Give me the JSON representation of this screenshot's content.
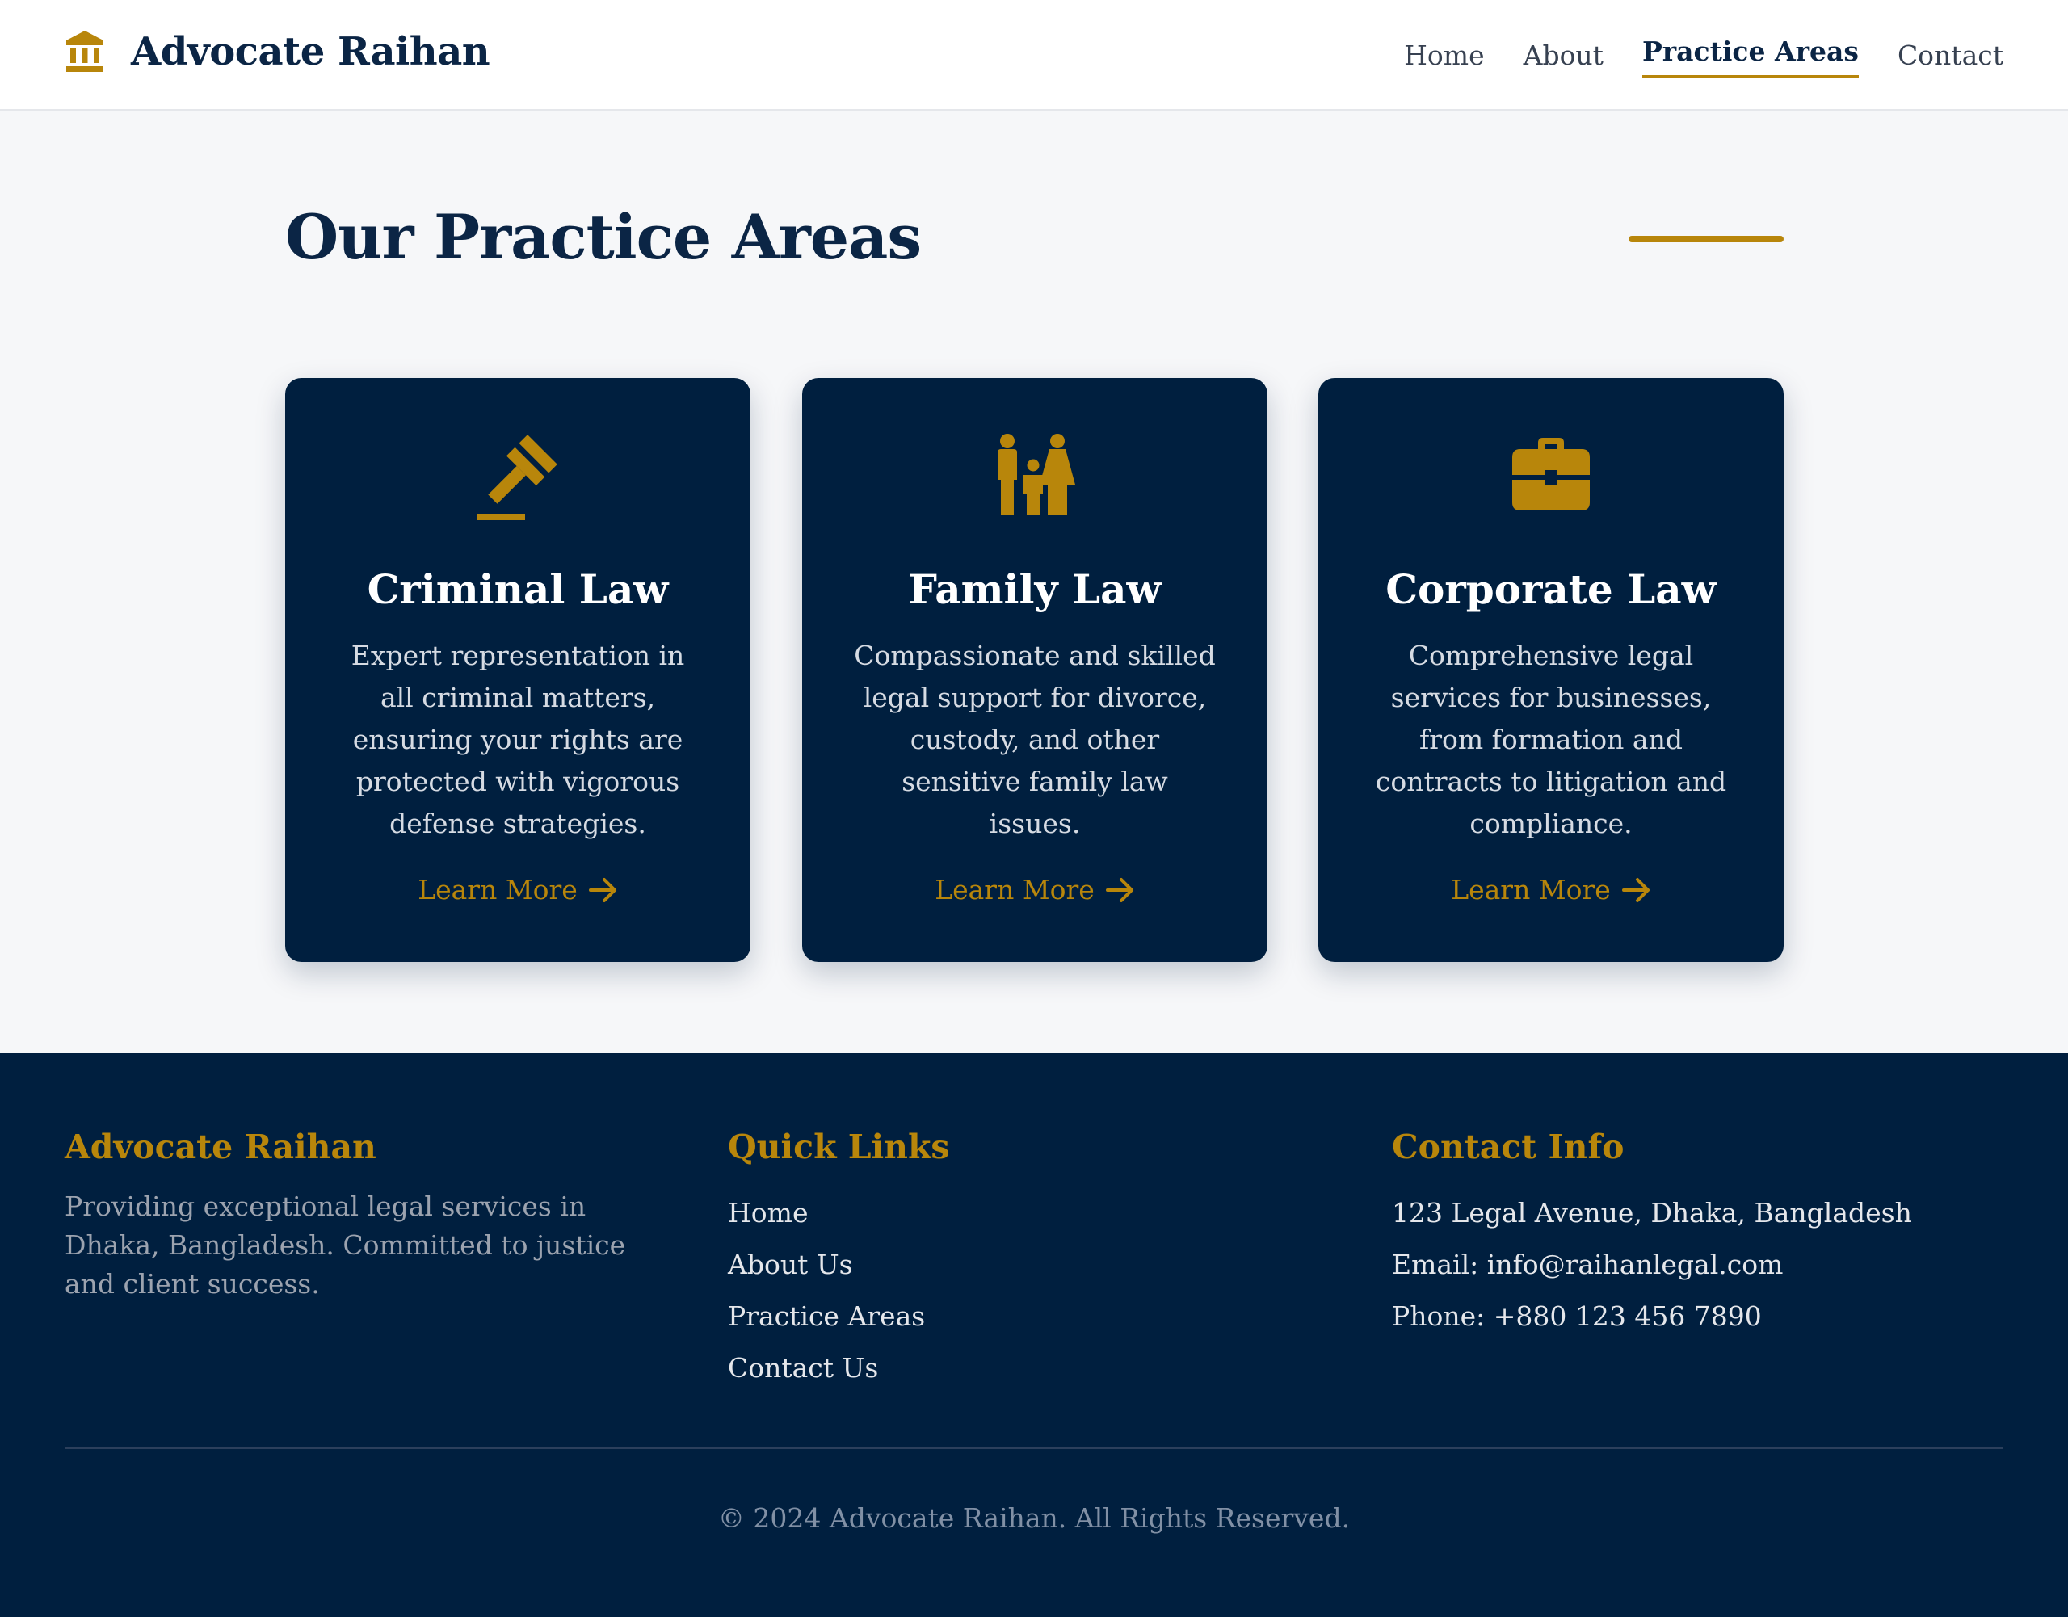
{
  "brand": {
    "name": "Advocate Raihan",
    "icon": "building-columns-icon"
  },
  "nav": {
    "items": [
      {
        "label": "Home",
        "active": false
      },
      {
        "label": "About",
        "active": false
      },
      {
        "label": "Practice Areas",
        "active": true
      },
      {
        "label": "Contact",
        "active": false
      }
    ]
  },
  "main": {
    "title": "Our Practice Areas",
    "cards": [
      {
        "icon": "gavel-icon",
        "title": "Criminal Law",
        "description": "Expert representation in all criminal matters, ensuring your rights are protected with vigorous defense strategies.",
        "link_label": "Learn More"
      },
      {
        "icon": "family-icon",
        "title": "Family Law",
        "description": "Compassionate and skilled legal support for divorce, custody, and other sensitive family law issues.",
        "link_label": "Learn More"
      },
      {
        "icon": "briefcase-icon",
        "title": "Corporate Law",
        "description": "Comprehensive legal services for businesses, from formation and contracts to litigation and compliance.",
        "link_label": "Learn More"
      }
    ]
  },
  "footer": {
    "about": {
      "heading": "Advocate Raihan",
      "text": "Providing exceptional legal services in Dhaka, Bangladesh. Committed to justice and client success."
    },
    "quick_links": {
      "heading": "Quick Links",
      "items": [
        "Home",
        "About Us",
        "Practice Areas",
        "Contact Us"
      ]
    },
    "contact": {
      "heading": "Contact Info",
      "address": "123 Legal Avenue, Dhaka, Bangladesh",
      "email": "Email: info@raihanlegal.com",
      "phone": "Phone: +880 123 456 7890"
    },
    "copyright": "© 2024 Advocate Raihan. All Rights Reserved."
  },
  "colors": {
    "navy": "#001f3f",
    "gold": "#b8860b",
    "page_bg": "#f6f7f9"
  }
}
